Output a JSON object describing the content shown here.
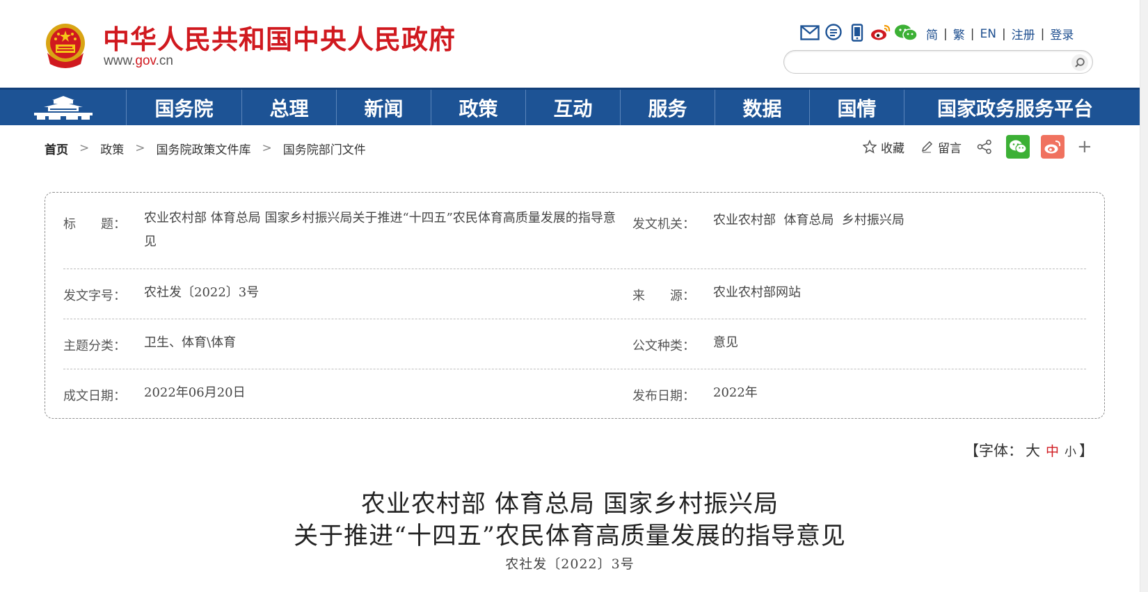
{
  "header": {
    "title": "中华人民共和国中央人民政府",
    "url_prefix": "www.",
    "url_domain": "gov",
    "url_suffix": ".cn",
    "lang_links": [
      "简",
      "繁",
      "EN",
      "注册",
      "登录"
    ],
    "search_placeholder": "",
    "icons": [
      "mail-icon",
      "message-icon",
      "mobile-icon",
      "weibo-icon",
      "wechat-icon"
    ]
  },
  "nav": {
    "items": [
      "国务院",
      "总理",
      "新闻",
      "政策",
      "互动",
      "服务",
      "数据",
      "国情",
      "国家政务服务平台"
    ]
  },
  "breadcrumb": {
    "items": [
      "首页",
      "政策",
      "国务院政策文件库",
      "国务院部门文件"
    ]
  },
  "share": {
    "favorite": "收藏",
    "comment": "留言"
  },
  "info": {
    "title_label": "标　　题：",
    "title_value": "农业农村部 体育总局 国家乡村振兴局关于推进“十四五”农民体育高质量发展的指导意见",
    "issuer_label": "发文机关：",
    "issuer_value": "农业农村部  体育总局  乡村振兴局",
    "docnum_label": "发文字号：",
    "docnum_value": "农社发〔2022〕3号",
    "source_label": "来　　源：",
    "source_value": "农业农村部网站",
    "topic_label": "主题分类：",
    "topic_value": "卫生、体育\\体育",
    "type_label": "公文种类：",
    "type_value": "意见",
    "written_label": "成文日期：",
    "written_value": "2022年06月20日",
    "published_label": "发布日期：",
    "published_value": "2022年"
  },
  "fontsize": {
    "open": "【字体：",
    "big": "大",
    "mid": "中",
    "small": "小",
    "close": "】"
  },
  "article": {
    "title_line1": "农业农村部 体育总局 国家乡村振兴局",
    "title_line2": "关于推进“十四五”农民体育高质量发展的指导意见",
    "doc_number": "农社发〔2022〕3号"
  },
  "colors": {
    "brand_red": "#d0191f",
    "nav_blue": "#1d5395",
    "link_blue": "#1d4e8f"
  }
}
